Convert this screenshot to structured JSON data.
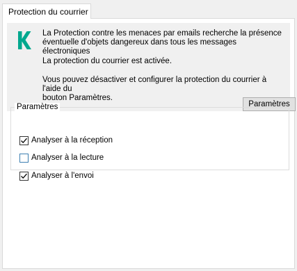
{
  "tab": {
    "label": "Protection du courrier"
  },
  "info": {
    "logo_icon": "kaspersky-k-logo",
    "brand_color": "#00a88e",
    "description_line1": "La Protection contre les menaces par emails recherche la présence",
    "description_line2": "éventuelle d'objets dangereux dans tous les messages électroniques",
    "status": "La protection du courrier est activée.",
    "hint_line1": "Vous pouvez désactiver et configurer la protection du courrier à l'aide du",
    "hint_line2": "bouton Paramètres.",
    "settings_button": "Paramètres"
  },
  "settings_group": {
    "title": "Paramètres",
    "options": [
      {
        "label": "Analyser à la réception",
        "checked": true
      },
      {
        "label": "Analyser à la lecture",
        "checked": false
      },
      {
        "label": "Analyser à l'envoi",
        "checked": true
      }
    ]
  }
}
